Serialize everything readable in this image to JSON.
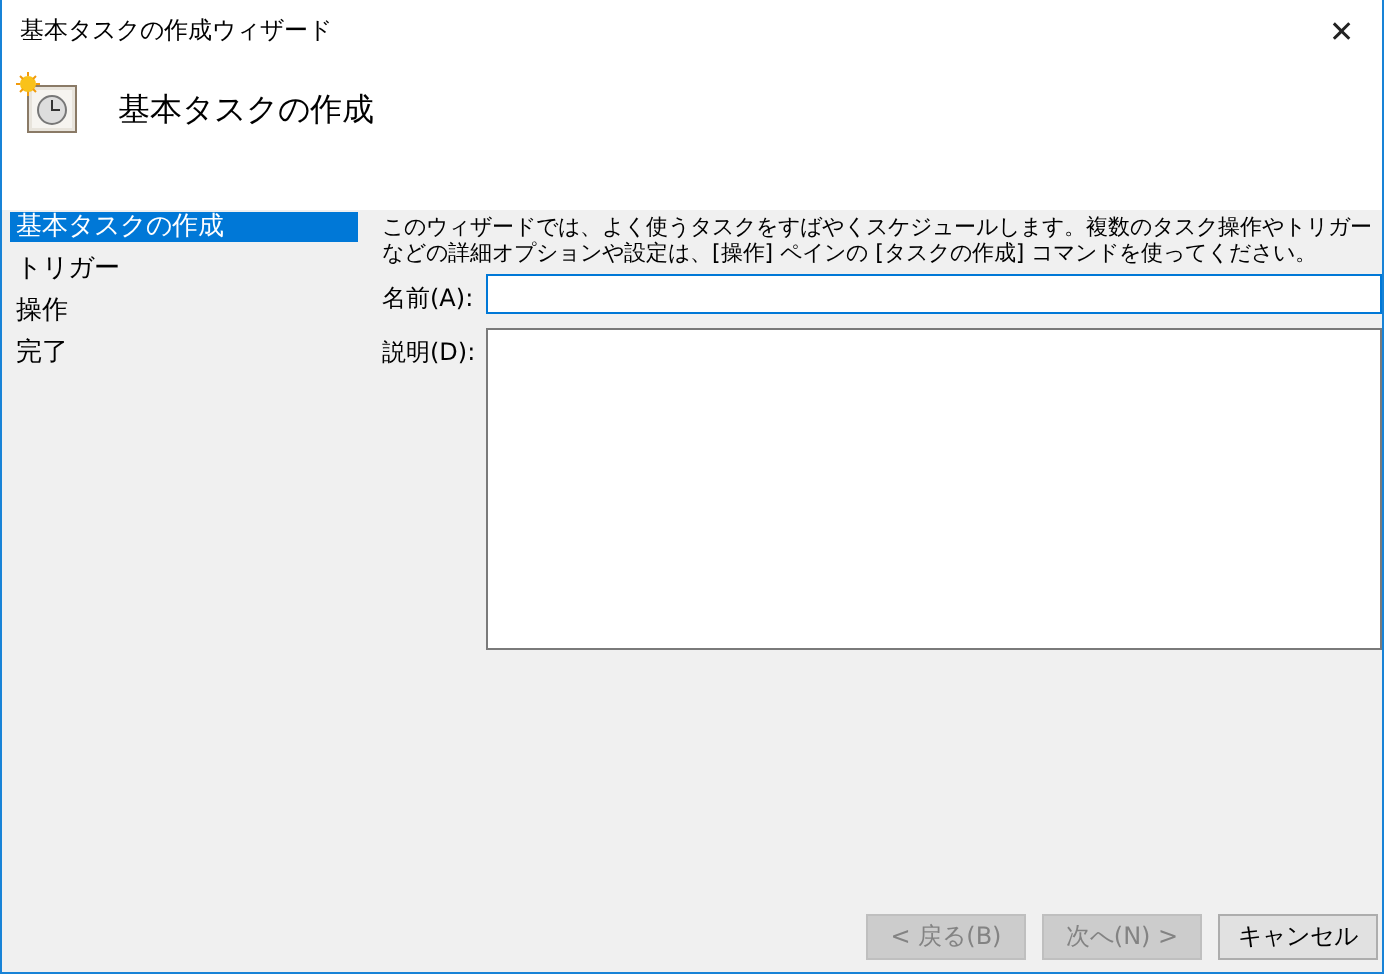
{
  "window": {
    "title": "基本タスクの作成ウィザード",
    "close": "✕"
  },
  "header": {
    "title": "基本タスクの作成"
  },
  "steps": [
    {
      "label": "基本タスクの作成",
      "selected": true
    },
    {
      "label": "トリガー",
      "selected": false
    },
    {
      "label": "操作",
      "selected": false
    },
    {
      "label": "完了",
      "selected": false
    }
  ],
  "description": "このウィザードでは、よく使うタスクをすばやくスケジュールします。複数のタスク操作やトリガーなどの詳細オプションや設定は、[操作] ペインの [タスクの作成] コマンドを使ってください。",
  "fields": [
    {
      "kind": "line",
      "label": "名前(A):",
      "focused": true
    },
    {
      "kind": "area",
      "label": "説明(D):",
      "focused": false
    }
  ],
  "buttons": [
    {
      "label": "< 戻る(B)",
      "disabled": true
    },
    {
      "label": "次へ(N) >",
      "disabled": true
    },
    {
      "label": "キャンセル",
      "disabled": false
    }
  ]
}
